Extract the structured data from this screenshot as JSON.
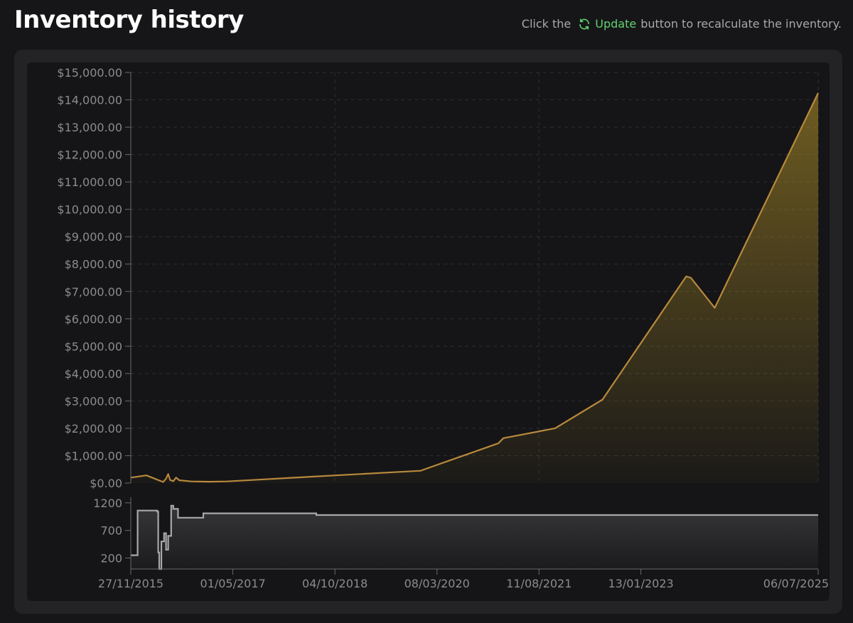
{
  "header": {
    "title": "Inventory history",
    "hint_prefix": "Click the",
    "update_label": "Update",
    "hint_suffix": "button to recalculate the inventory."
  },
  "colors": {
    "value_line": "#b8893c",
    "quantity_line": "#a8a8a8",
    "update_accent": "#5fd26f",
    "tick_text": "#8c8c8c"
  },
  "chart_data": [
    {
      "type": "area",
      "name": "inventory-value",
      "ylim": [
        0,
        15000
      ],
      "yticks": [
        0,
        1000,
        2000,
        3000,
        4000,
        5000,
        6000,
        7000,
        8000,
        9000,
        10000,
        11000,
        12000,
        13000,
        14000,
        15000
      ],
      "ytick_labels": [
        "$0.00",
        "$1,000.00",
        "$2,000.00",
        "$3,000.00",
        "$4,000.00",
        "$5,000.00",
        "$6,000.00",
        "$7,000.00",
        "$8,000.00",
        "$9,000.00",
        "$10,000.00",
        "$11,000.00",
        "$12,000.00",
        "$13,000.00",
        "$14,000.00",
        "$15,000.00"
      ],
      "xlim": [
        "2015-11-27",
        "2025-07-06"
      ],
      "grid": true,
      "points": [
        {
          "x": "2015-11-27",
          "y": 200
        },
        {
          "x": "2016-02-15",
          "y": 280
        },
        {
          "x": "2016-04-25",
          "y": 80
        },
        {
          "x": "2016-05-10",
          "y": 40
        },
        {
          "x": "2016-05-25",
          "y": 160
        },
        {
          "x": "2016-06-05",
          "y": 330
        },
        {
          "x": "2016-06-15",
          "y": 110
        },
        {
          "x": "2016-07-01",
          "y": 70
        },
        {
          "x": "2016-07-15",
          "y": 200
        },
        {
          "x": "2016-08-01",
          "y": 100
        },
        {
          "x": "2016-10-01",
          "y": 60
        },
        {
          "x": "2017-01-01",
          "y": 50
        },
        {
          "x": "2017-04-01",
          "y": 60
        },
        {
          "x": "2018-06-01",
          "y": 230
        },
        {
          "x": "2019-12-15",
          "y": 450
        },
        {
          "x": "2020-01-15",
          "y": 530
        },
        {
          "x": "2021-01-15",
          "y": 1450
        },
        {
          "x": "2021-02-10",
          "y": 1640
        },
        {
          "x": "2021-11-01",
          "y": 2000
        },
        {
          "x": "2022-07-01",
          "y": 3050
        },
        {
          "x": "2023-09-01",
          "y": 7550
        },
        {
          "x": "2023-09-25",
          "y": 7500
        },
        {
          "x": "2024-01-25",
          "y": 6400
        },
        {
          "x": "2025-07-06",
          "y": 14250
        }
      ]
    },
    {
      "type": "line",
      "name": "inventory-quantity",
      "step": true,
      "ylim": [
        0,
        1250
      ],
      "yticks": [
        200,
        700,
        1200
      ],
      "ytick_labels": [
        "200",
        "700",
        "1200"
      ],
      "xlim": [
        "2015-11-27",
        "2025-07-06"
      ],
      "xticks": [
        "2015-11-27",
        "2017-05-01",
        "2018-10-04",
        "2020-03-08",
        "2021-08-11",
        "2023-01-13",
        "2025-07-06"
      ],
      "xtick_labels": [
        "27/11/2015",
        "01/05/2017",
        "04/10/2018",
        "08/03/2020",
        "11/08/2021",
        "13/01/2023",
        "06/07/2025"
      ],
      "points": [
        {
          "x": "2015-11-27",
          "y": 250
        },
        {
          "x": "2016-01-01",
          "y": 1060
        },
        {
          "x": "2016-04-10",
          "y": 1040
        },
        {
          "x": "2016-04-15",
          "y": 300
        },
        {
          "x": "2016-04-20",
          "y": 0
        },
        {
          "x": "2016-05-01",
          "y": 500
        },
        {
          "x": "2016-05-15",
          "y": 650
        },
        {
          "x": "2016-05-25",
          "y": 350
        },
        {
          "x": "2016-06-05",
          "y": 600
        },
        {
          "x": "2016-06-20",
          "y": 1150
        },
        {
          "x": "2016-07-01",
          "y": 1090
        },
        {
          "x": "2016-07-25",
          "y": 930
        },
        {
          "x": "2016-12-01",
          "y": 1010
        },
        {
          "x": "2018-07-01",
          "y": 980
        },
        {
          "x": "2025-07-06",
          "y": 980
        }
      ]
    }
  ]
}
